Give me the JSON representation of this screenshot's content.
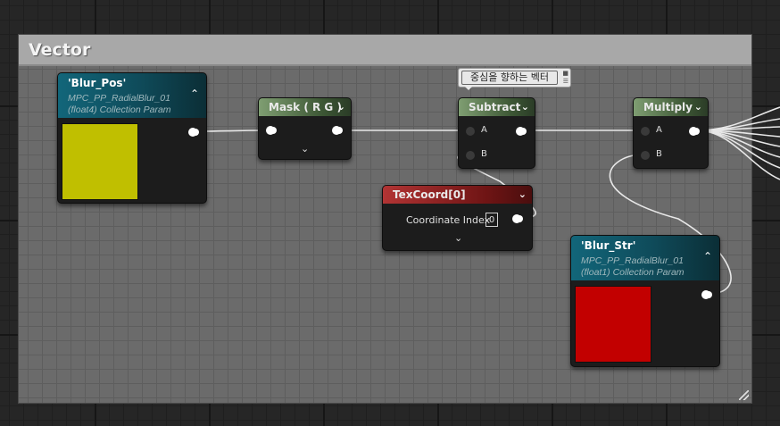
{
  "comment": {
    "title": "Vector"
  },
  "tooltip": {
    "text": "중심을 향하는 벡터"
  },
  "nodes": {
    "blur_pos": {
      "name": "'Blur_Pos'",
      "line1": "MPC_PP_RadialBlur_01",
      "line2": "(float4) Collection Param",
      "color": "#c0bf00"
    },
    "mask": {
      "title": "Mask ( R G )"
    },
    "subtract": {
      "title": "Subtract",
      "pin_a": "A",
      "pin_b": "B"
    },
    "multiply": {
      "title": "Multiply",
      "pin_a": "A",
      "pin_b": "B"
    },
    "texcoord": {
      "title": "TexCoord[0]",
      "field_label": "Coordinate Index",
      "field_value": "0"
    },
    "blur_str": {
      "name": "'Blur_Str'",
      "line1": "MPC_PP_RadialBlur_01",
      "line2": "(float1) Collection Param",
      "color": "#c20000"
    }
  }
}
